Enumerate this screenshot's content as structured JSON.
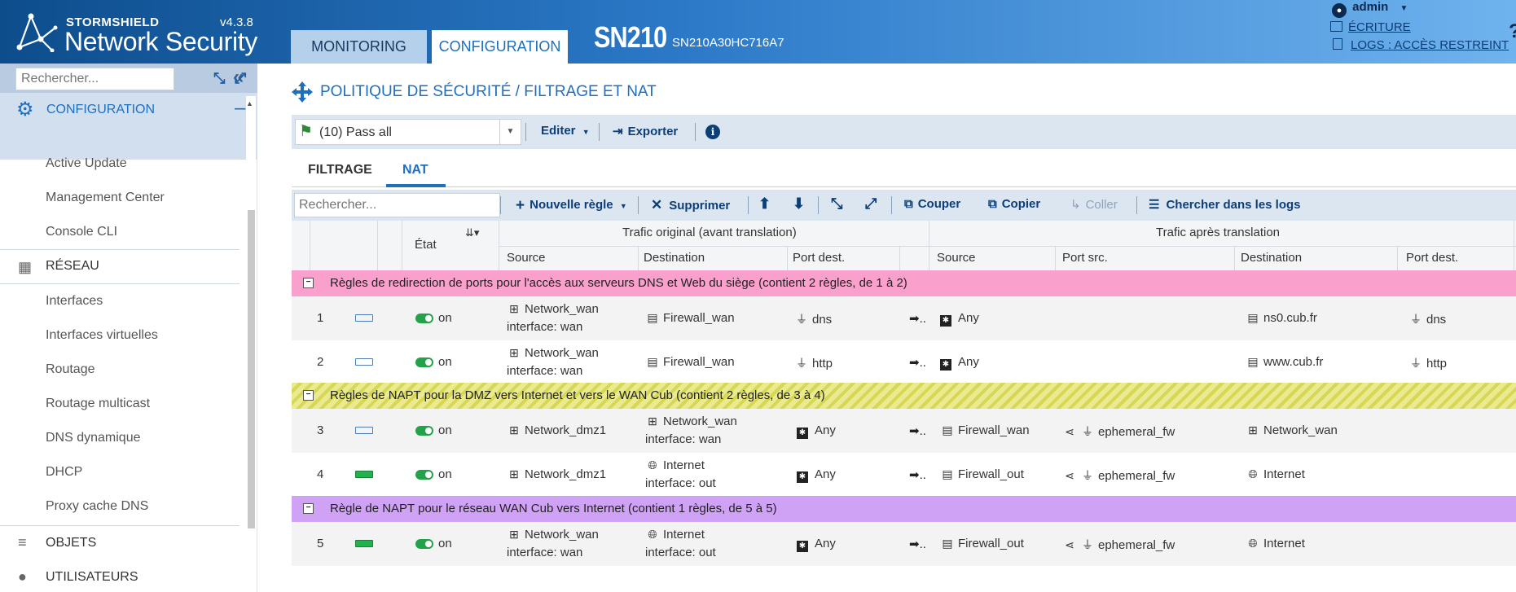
{
  "header": {
    "brand_small": "STORMSHIELD",
    "brand_big": "Network Security",
    "version": "v4.3.8",
    "tabs": [
      {
        "label": "MONITORING",
        "active": false
      },
      {
        "label": "CONFIGURATION",
        "active": true
      }
    ],
    "model": "SN210",
    "serial": "SN210A30HC716A7",
    "user": "admin",
    "write_mode": "ÉCRITURE",
    "logs_access": "LOGS : ACCÈS RESTREINT",
    "help": "?"
  },
  "sidebar": {
    "section_title": "CONFIGURATION",
    "search_placeholder": "Rechercher...",
    "items_top": [
      "Active Update",
      "Management Center",
      "Console CLI"
    ],
    "reseau": {
      "title": "RÉSEAU",
      "items": [
        "Interfaces",
        "Interfaces virtuelles",
        "Routage",
        "Routage multicast",
        "DNS dynamique",
        "DHCP",
        "Proxy cache DNS"
      ]
    },
    "objets": "OBJETS",
    "utilisateurs": "UTILISATEURS"
  },
  "main": {
    "title": "POLITIQUE DE SÉCURITÉ / FILTRAGE ET NAT",
    "policy_selected": "(10) Pass all",
    "toolbar1": {
      "edit": "Editer",
      "export": "Exporter"
    },
    "subtabs": [
      {
        "label": "FILTRAGE",
        "active": false
      },
      {
        "label": "NAT",
        "active": true
      }
    ],
    "toolbar2": {
      "search_placeholder": "Rechercher...",
      "new_rule": "Nouvelle règle",
      "delete": "Supprimer",
      "cut": "Couper",
      "copy": "Copier",
      "paste": "Coller",
      "search_logs": "Chercher dans les logs"
    }
  },
  "table": {
    "col_state": "État",
    "group_original": "Trafic original (avant translation)",
    "group_after": "Trafic après translation",
    "cols_original": [
      "Source",
      "Destination",
      "Port dest."
    ],
    "cols_after": [
      "Source",
      "Port src.",
      "Destination",
      "Port dest."
    ],
    "groups": [
      {
        "label": "Règles de redirection de ports pour l'accès aux serveurs DNS et Web du siège  (contient 2 règles, de 1 à 2)",
        "color": "#f9a0cd"
      },
      {
        "label": "Règles de NAPT pour la DMZ vers Internet et vers le WAN Cub  (contient 2 règles, de 3 à 4)",
        "color": "#eaea90"
      },
      {
        "label": "Règle de NAPT pour le réseau WAN Cub vers Internet  (contient 1 règles, de 5 à 5)",
        "color": "#cfa2f5"
      }
    ],
    "rules": [
      {
        "num": "1",
        "state": "on",
        "src": "Network_wan",
        "src_if": "interface: wan",
        "dst": "Firewall_wan",
        "dst_if": "",
        "port": "dns",
        "t_src": "Any",
        "t_psrc": "",
        "t_dst": "ns0.cub.fr",
        "t_port": "dns"
      },
      {
        "num": "2",
        "state": "on",
        "src": "Network_wan",
        "src_if": "interface: wan",
        "dst": "Firewall_wan",
        "dst_if": "",
        "port": "http",
        "t_src": "Any",
        "t_psrc": "",
        "t_dst": "www.cub.fr",
        "t_port": "http"
      },
      {
        "num": "3",
        "state": "on",
        "src": "Network_dmz1",
        "src_if": "",
        "dst": "Network_wan",
        "dst_if": "interface: wan",
        "port": "Any",
        "t_src": "Firewall_wan",
        "t_psrc": "ephemeral_fw",
        "t_dst": "Network_wan",
        "t_port": ""
      },
      {
        "num": "4",
        "state": "on",
        "src": "Network_dmz1",
        "src_if": "",
        "dst": "Internet",
        "dst_if": "interface: out",
        "port": "Any",
        "t_src": "Firewall_out",
        "t_psrc": "ephemeral_fw",
        "t_dst": "Internet",
        "t_port": ""
      },
      {
        "num": "5",
        "state": "on",
        "src": "Network_wan",
        "src_if": "interface: wan",
        "dst": "Internet",
        "dst_if": "interface: out",
        "port": "Any",
        "t_src": "Firewall_out",
        "t_psrc": "ephemeral_fw",
        "t_dst": "Internet",
        "t_port": ""
      }
    ]
  }
}
